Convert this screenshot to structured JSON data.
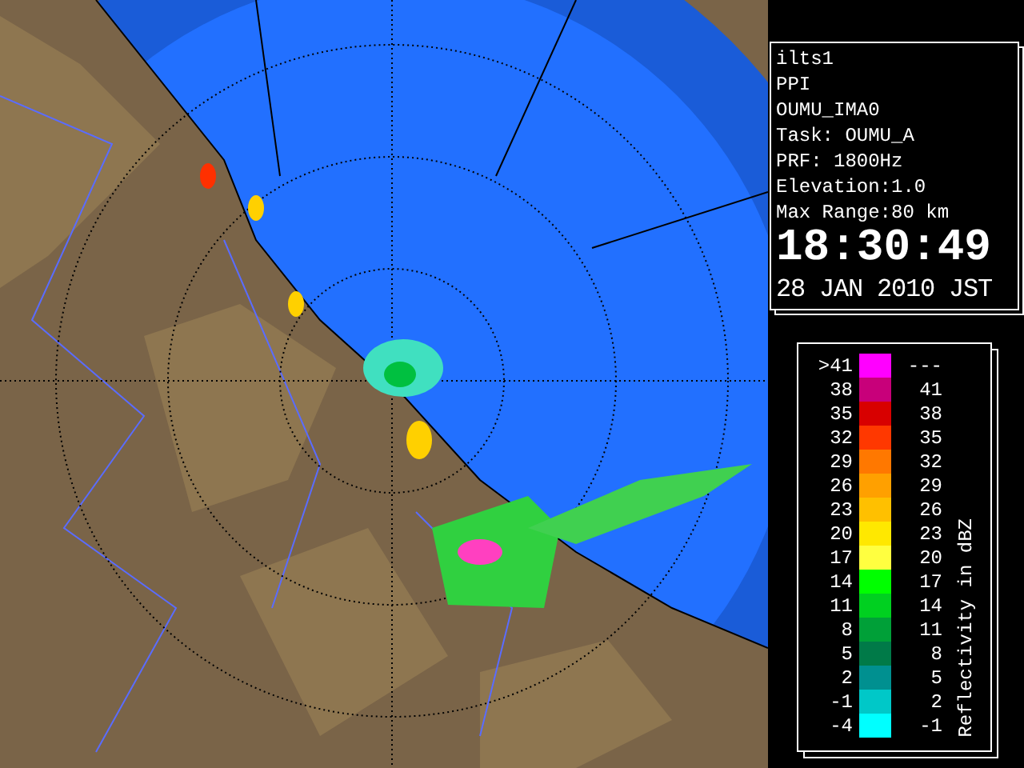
{
  "info": {
    "lines": [
      "ilts1",
      "PPI",
      "OUMU_IMA0",
      "Task: OUMU_A",
      "PRF: 1800Hz",
      "Elevation:1.0",
      "Max Range:80 km"
    ],
    "time": "18:30:49",
    "date": "28 JAN 2010 JST"
  },
  "legend": {
    "title": "Reflectivity in dBZ",
    "rows": [
      {
        "low": ">41",
        "high": "---",
        "color": "#ff00ff"
      },
      {
        "low": "38",
        "high": "41",
        "color": "#c8007a"
      },
      {
        "low": "35",
        "high": "38",
        "color": "#d80000"
      },
      {
        "low": "32",
        "high": "35",
        "color": "#ff3800"
      },
      {
        "low": "29",
        "high": "32",
        "color": "#ff7800"
      },
      {
        "low": "26",
        "high": "29",
        "color": "#ffa000"
      },
      {
        "low": "23",
        "high": "26",
        "color": "#ffc000"
      },
      {
        "low": "20",
        "high": "23",
        "color": "#ffe800"
      },
      {
        "low": "17",
        "high": "20",
        "color": "#ffff40"
      },
      {
        "low": "14",
        "high": "17",
        "color": "#00ff00"
      },
      {
        "low": "11",
        "high": "14",
        "color": "#00d020"
      },
      {
        "low": "8",
        "high": "11",
        "color": "#00a038"
      },
      {
        "low": "5",
        "high": "8",
        "color": "#007a48"
      },
      {
        "low": "2",
        "high": "5",
        "color": "#009090"
      },
      {
        "low": "-1",
        "high": "2",
        "color": "#00c8c8"
      },
      {
        "low": "-4",
        "high": "-1",
        "color": "#00ffff"
      }
    ]
  }
}
